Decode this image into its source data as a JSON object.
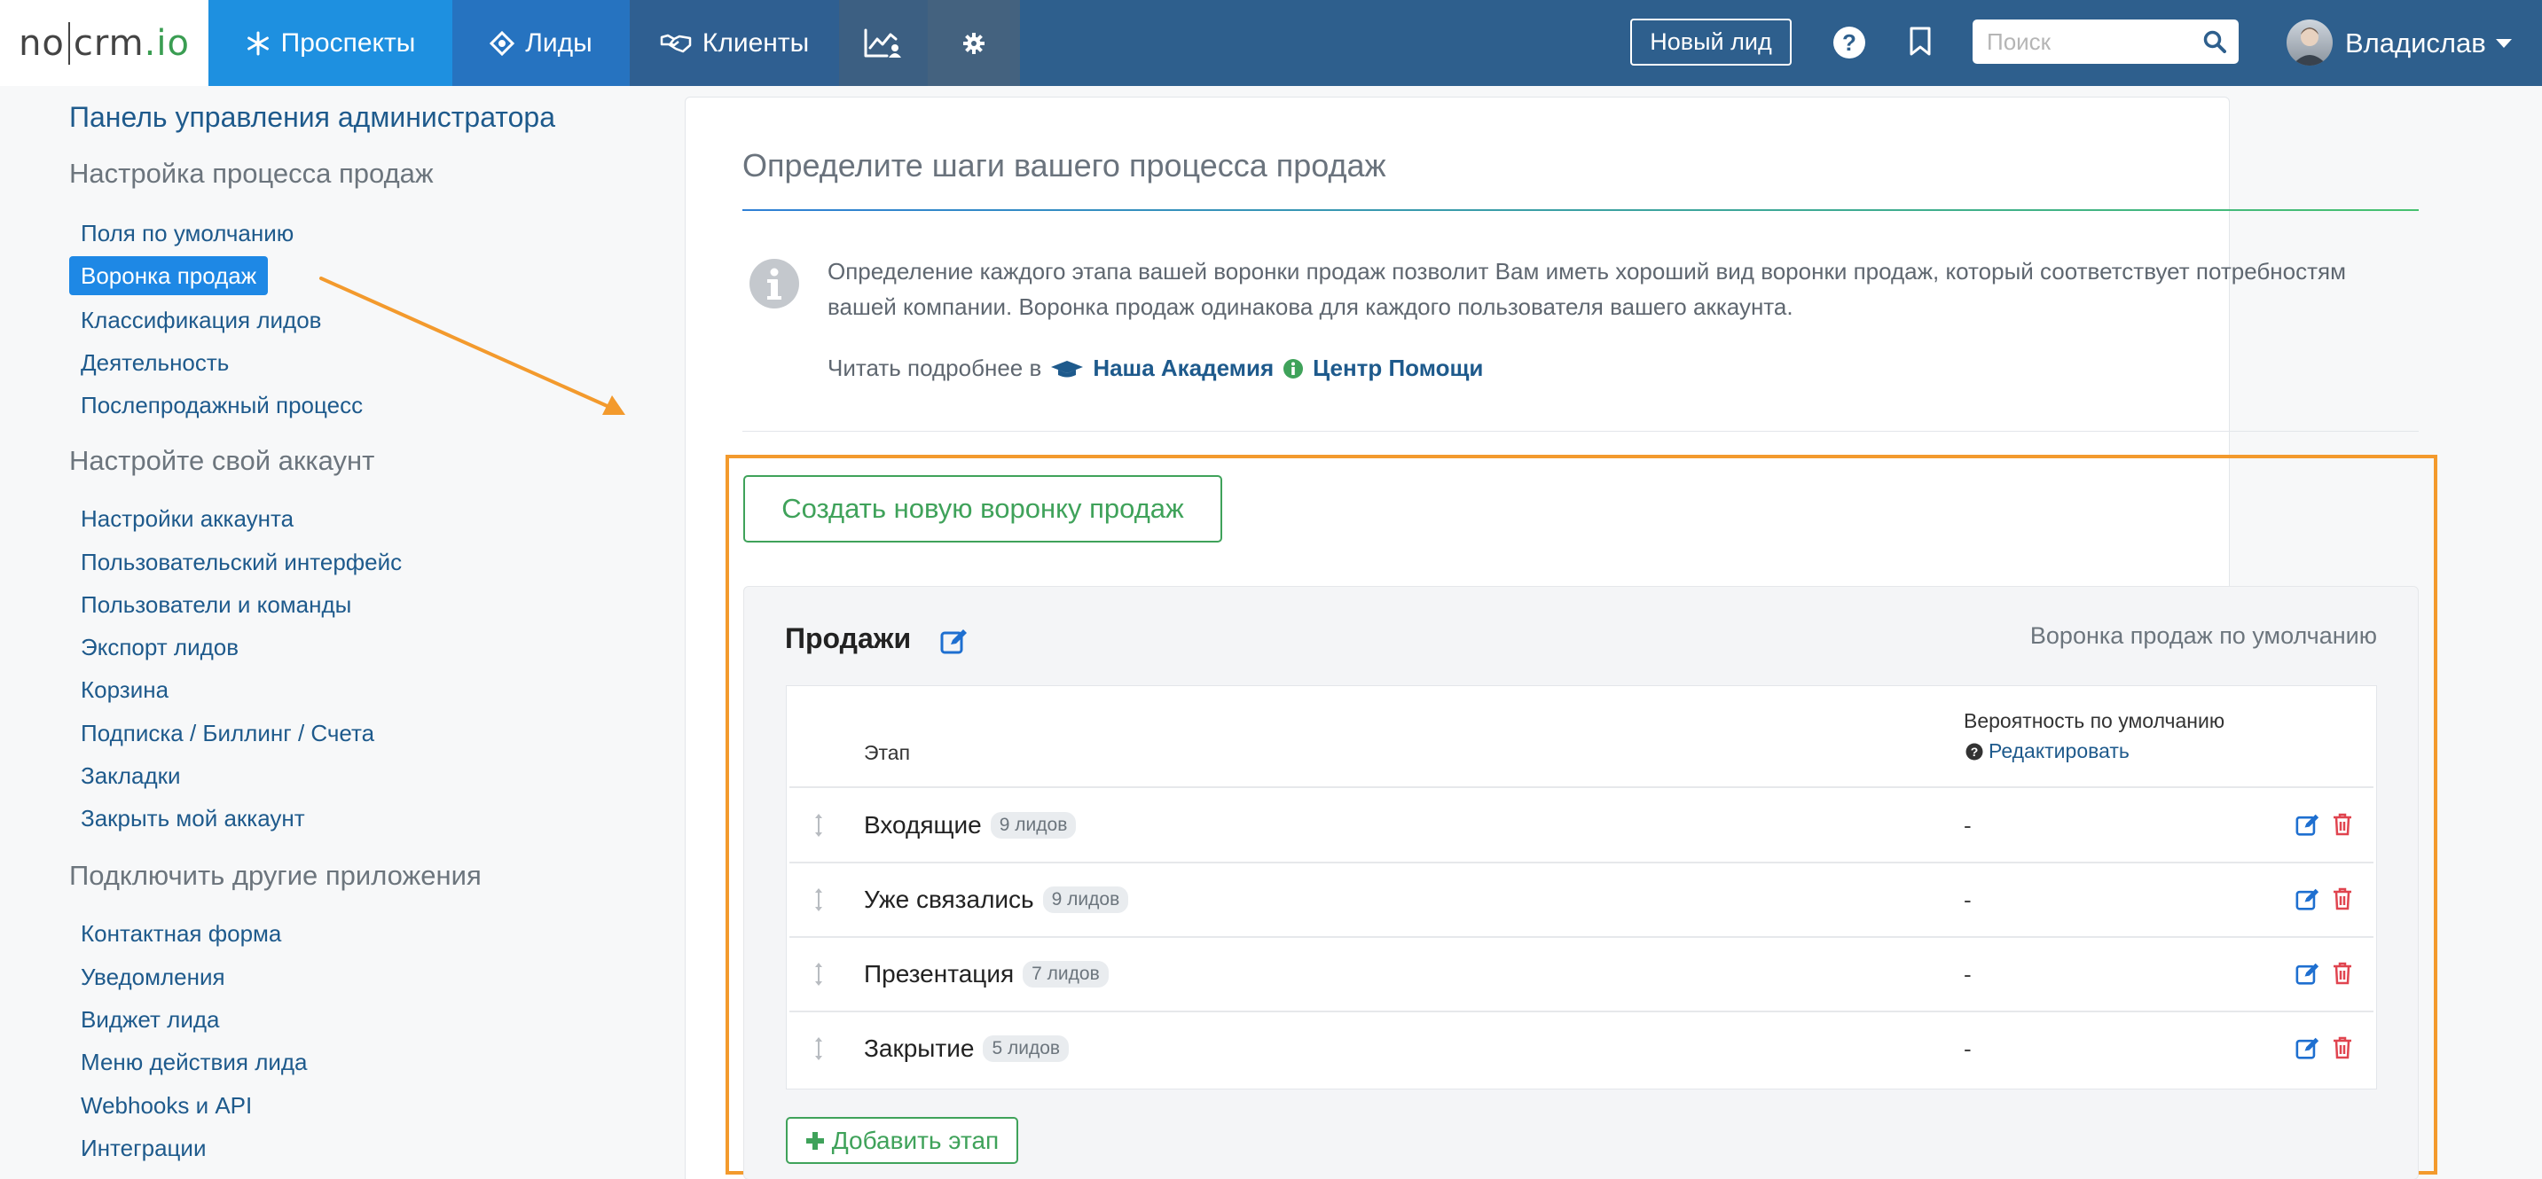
{
  "topbar": {
    "logo": {
      "part1": "no",
      "part2": "crm",
      "part3": ".io"
    },
    "nav": {
      "prospects": "Проспекты",
      "leads": "Лиды",
      "clients": "Клиенты"
    },
    "new_lead": "Новый лид",
    "search_placeholder": "Поиск",
    "user_name": "Владислав"
  },
  "sidebar": {
    "title": "Панель управления администратора",
    "sections": [
      {
        "heading": "Настройка процесса продаж",
        "items": [
          "Поля по умолчанию",
          "Воронка продаж",
          "Классификация лидов",
          "Деятельность",
          "Послепродажный процесс"
        ]
      },
      {
        "heading": "Настройте свой аккаунт",
        "items": [
          "Настройки аккаунта",
          "Пользовательский интерфейс",
          "Пользователи и команды",
          "Экспорт лидов",
          "Корзина",
          "Подписка / Биллинг / Счета",
          "Закладки",
          "Закрыть мой аккаунт"
        ]
      },
      {
        "heading": "Подключить другие приложения",
        "items": [
          "Контактная форма",
          "Уведомления",
          "Виджет лида",
          "Меню действия лида",
          "Webhooks и API",
          "Интеграции"
        ]
      }
    ]
  },
  "main": {
    "title": "Определите шаги вашего процесса продаж",
    "info_text": "Определение каждого этапа вашей воронки продаж позволит Вам иметь хороший вид воронки продаж, который соответствует потребностям вашей компании. Воронка продаж одинакова для каждого пользователя вашего аккаунта.",
    "read_more_prefix": "Читать подробнее в",
    "academy_link": "Наша Академия",
    "help_center_link": "Центр Помощи",
    "create_pipeline_button": "Создать новую воронку продаж",
    "pipeline": {
      "name": "Продажи",
      "default_label": "Воронка продаж по умолчанию",
      "col_stage": "Этап",
      "col_probability": "Вероятность по умолчанию",
      "edit_probability": "Редактировать",
      "stages": [
        {
          "name": "Входящие",
          "badge": "9 лидов",
          "probability": "-"
        },
        {
          "name": "Уже связались",
          "badge": "9 лидов",
          "probability": "-"
        },
        {
          "name": "Презентация",
          "badge": "7 лидов",
          "probability": "-"
        },
        {
          "name": "Закрытие",
          "badge": "5 лидов",
          "probability": "-"
        }
      ],
      "add_stage_button": "Добавить этап"
    }
  },
  "colors": {
    "topbar": "#2e5f8d",
    "nav_active": "#1e90e0",
    "sidebar_active": "#1e88e5",
    "green": "#3fa25a",
    "highlight": "#f39a2d",
    "delete_red": "#e0444f"
  }
}
